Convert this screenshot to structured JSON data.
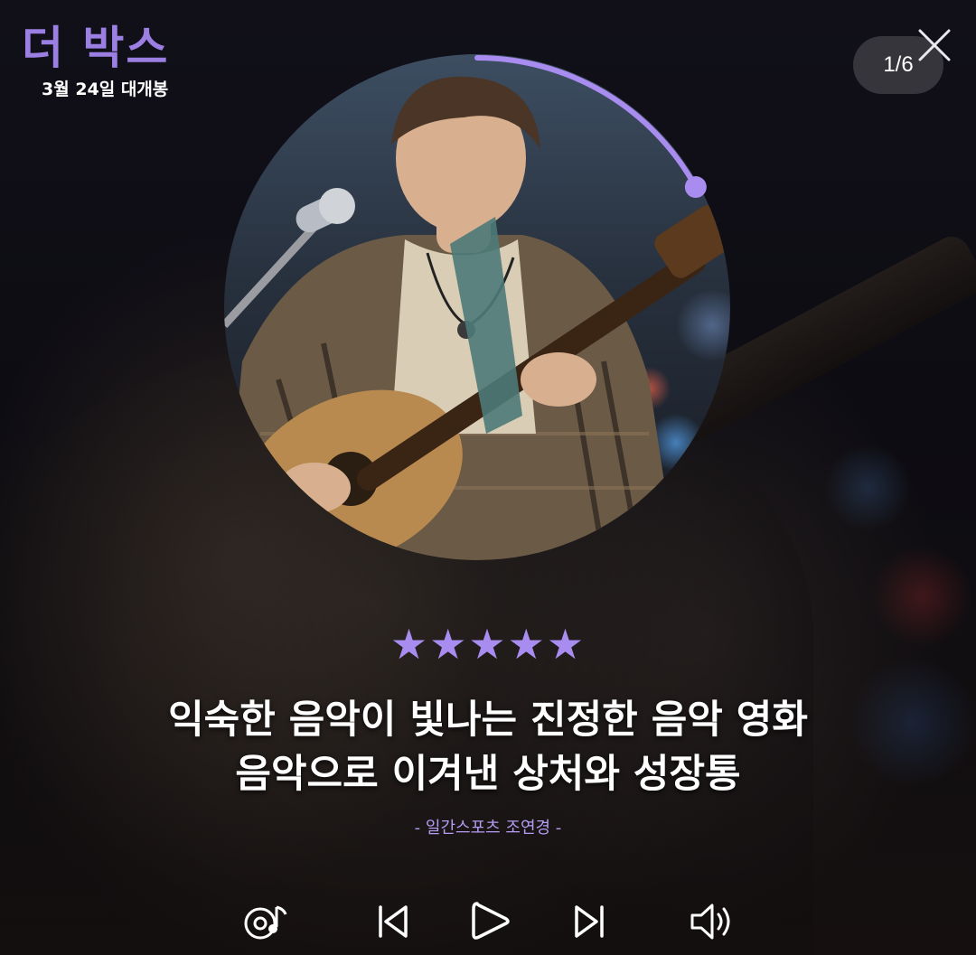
{
  "poster": {
    "title": "더 박스",
    "release": "3월 24일 대개봉"
  },
  "viewer": {
    "counter": "1/6",
    "progress_fraction": 0.17
  },
  "review": {
    "stars": "★★★★★",
    "rating": 5,
    "line1": "익숙한 음악이 빛나는 진정한 음악 영화",
    "line2": "음악으로 이겨낸 상처와 성장통",
    "source": "- 일간스포츠 조연경 -"
  },
  "controls": {
    "icons": [
      "music-disc-icon",
      "previous-track-icon",
      "play-icon",
      "next-track-icon",
      "volume-icon"
    ]
  },
  "colors": {
    "accent": "#a98cf0",
    "title": "#9c7fe3"
  }
}
